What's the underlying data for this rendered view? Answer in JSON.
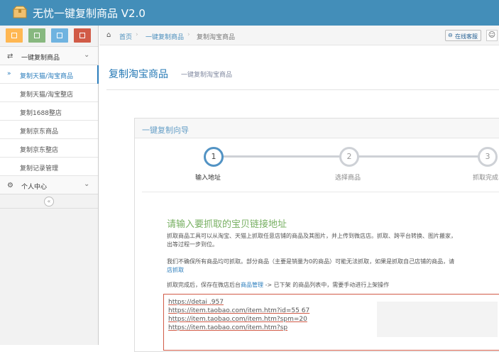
{
  "app": {
    "title": "无忧一键复制商品 V2.0"
  },
  "colors": {
    "header": "#438eb9",
    "accent": "#2b7dbc",
    "prompt": "#78b063",
    "url_border": "#d15b47",
    "shortcut_green": "#87b87f",
    "shortcut_yellow": "#ffb752",
    "shortcut_blue": "#6fb3e0",
    "shortcut_red": "#d15b47"
  },
  "shortcuts": [
    {
      "icon": "calendar-icon"
    },
    {
      "icon": "square-icon"
    },
    {
      "icon": "grid-icon"
    },
    {
      "icon": "book-icon"
    }
  ],
  "sidebar": {
    "group1": {
      "label": "一键复制商品",
      "icon": "shuffle-icon"
    },
    "items": [
      {
        "label": "复制天猫/淘宝商品",
        "active": true
      },
      {
        "label": "复制天猫/淘宝整店"
      },
      {
        "label": "复制1688整店"
      },
      {
        "label": "复制京东商品"
      },
      {
        "label": "复制京东整店"
      },
      {
        "label": "复制记录管理"
      }
    ],
    "group2": {
      "label": "个人中心",
      "icon": "gear-icon"
    }
  },
  "breadcrumb": {
    "home": "首页",
    "level2": "一键复制商品",
    "current": "复制淘宝商品"
  },
  "service_button": "在线客服",
  "page": {
    "title": "复制淘宝商品",
    "subtitle": "一键复制淘宝商品"
  },
  "wizard": {
    "header": "一键复制向导",
    "steps": [
      {
        "num": "1",
        "label": "输入地址"
      },
      {
        "num": "2",
        "label": "选择商品"
      },
      {
        "num": "3",
        "label": "抓取完成"
      }
    ],
    "prompt": "请输入要抓取的宝贝链接地址",
    "para1": "抓取商品工具可以从淘宝、天猫上抓取任意店铺的商品及其图片，并上传到微店店。抓取、跨平台转换、图片搬家，",
    "para1b": "出等过程一步到位。",
    "para2": "我们不确保所有商品均可抓取。部分商品（主要是销量为0的商品）可能无法抓取，如果是抓取自己店铺的商品，请",
    "para2_link": "店抓取",
    "para3_pre": "抓取完成后，保存在微店后台",
    "para3_link": "商品管理",
    "para3_post": " -> 已下架 的商品列表中，需要手动进行上架操作",
    "urls": [
      "https://detai                              .957",
      "https://item.taobao.com/item.htm?id=55               67",
      "https://item.taobao.com/item.htm?spm=20",
      "https://item.taobao.com/item.htm?sp"
    ]
  }
}
